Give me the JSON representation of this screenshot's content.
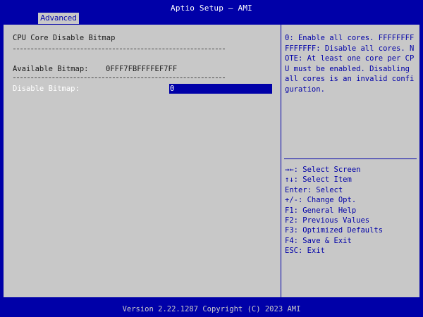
{
  "app": {
    "title": "Aptio Setup – AMI"
  },
  "tabs": [
    {
      "label": "Advanced",
      "active": true
    }
  ],
  "main": {
    "section_title": "CPU Core Disable Bitmap",
    "available_bitmap_label": "Available Bitmap:",
    "available_bitmap_value": "0FFF7FBFFFFEF7FF",
    "disable_bitmap_label": "Disable Bitmap:",
    "disable_bitmap_value": "0"
  },
  "help": {
    "description": "0: Enable all cores. FFFFFFFFFFFFFFF: Disable all cores. NOTE: At least one core per CPU must be enabled. Disabling all cores is an invalid configuration.",
    "keys": [
      "→←: Select Screen",
      "↑↓: Select Item",
      "Enter: Select",
      "+/-: Change Opt.",
      "F1: General Help",
      "F2: Previous Values",
      "F3: Optimized Defaults",
      "F4: Save & Exit",
      "ESC: Exit"
    ]
  },
  "footer": {
    "text": "Version 2.22.1287 Copyright (C) 2023 AMI"
  },
  "colors": {
    "background": "#0000a8",
    "panel": "#c8c8c8",
    "text_dark": "#1a1a1a",
    "text_help": "#0000a8",
    "highlight": "#0000a8",
    "highlight_text": "#ffffff"
  }
}
